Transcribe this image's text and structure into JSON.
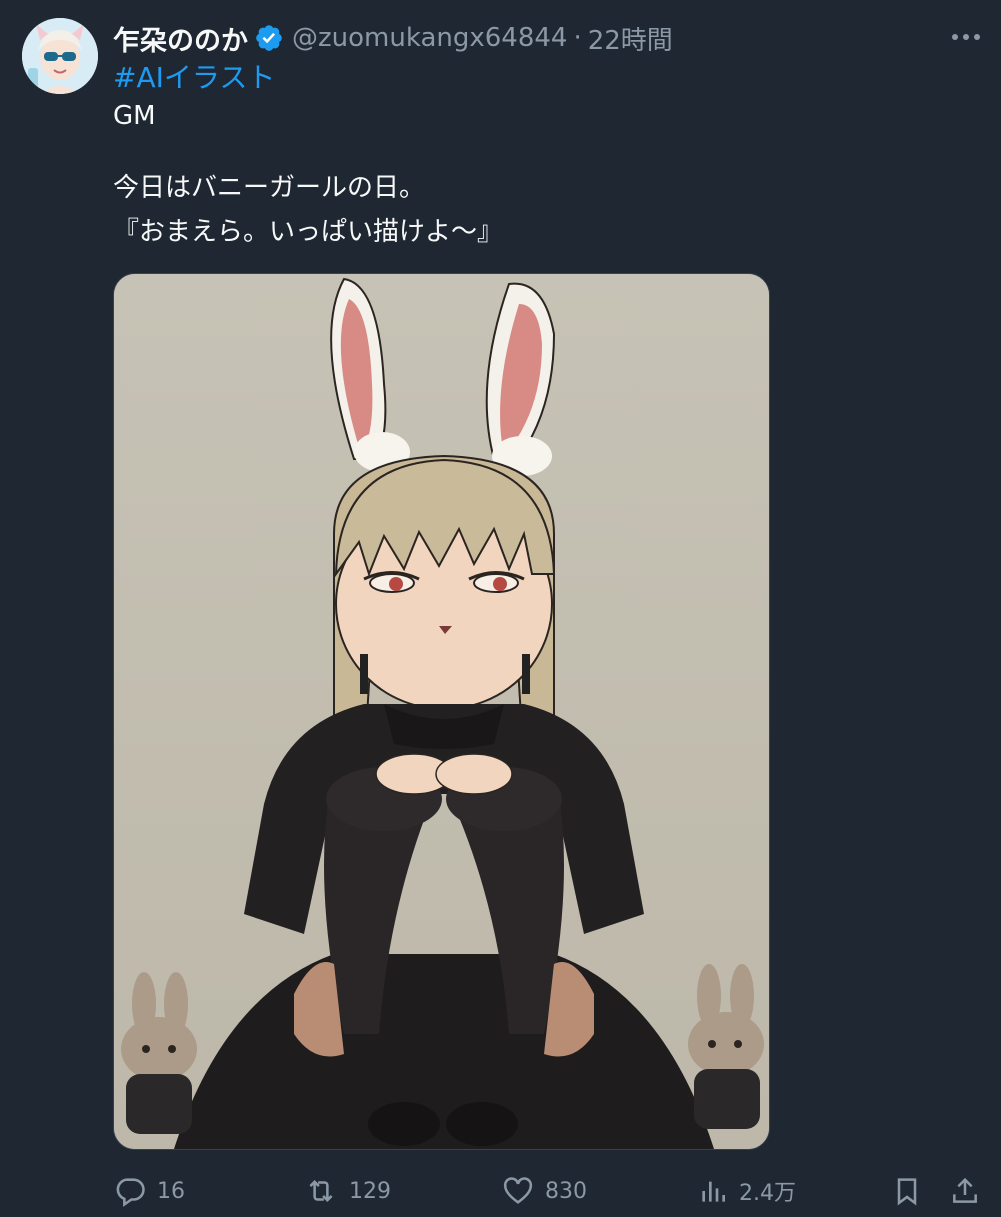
{
  "tweet": {
    "display_name": "乍朶ののか",
    "verified_icon": "verified-badge-icon",
    "handle": "@zuomukangx64844",
    "separator": "·",
    "time": "22時間",
    "hashtag": "#AIイラスト",
    "lines": [
      "GM",
      "今日はバニーガールの日。",
      "『おまえら。いっぱい描けよ〜』"
    ],
    "media_icon": "illustration-image"
  },
  "actions": {
    "reply": {
      "icon": "reply-icon",
      "count": "16"
    },
    "retweet": {
      "icon": "retweet-icon",
      "count": "129"
    },
    "like": {
      "icon": "heart-icon",
      "count": "830"
    },
    "views": {
      "icon": "analytics-icon",
      "count": "2.4万"
    },
    "bookmark": {
      "icon": "bookmark-icon"
    },
    "share": {
      "icon": "share-icon"
    }
  },
  "colors": {
    "background": "#1e2732",
    "text": "#f7f9f9",
    "muted": "#8b98a5",
    "accent": "#1d9bf0"
  }
}
